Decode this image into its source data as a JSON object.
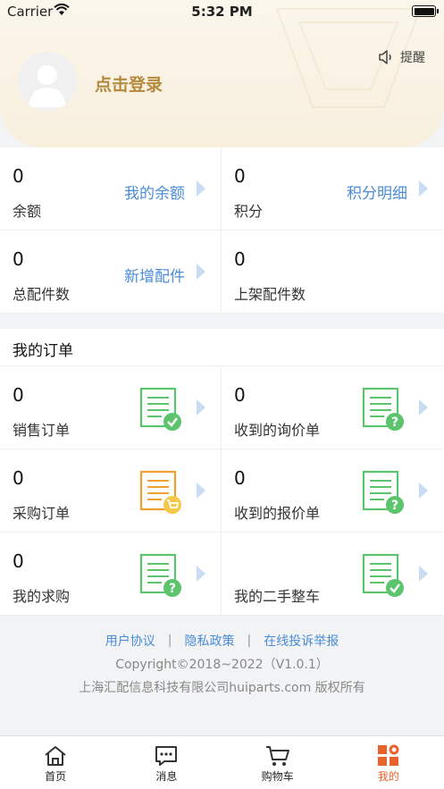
{
  "status_bar": {
    "carrier": "Carrier",
    "time": "5:32 PM"
  },
  "header": {
    "login_text": "点击登录",
    "remind_label": "提醒"
  },
  "account": [
    {
      "value": "0",
      "label": "余额",
      "link": "我的余额"
    },
    {
      "value": "0",
      "label": "积分",
      "link": "积分明细"
    },
    {
      "value": "0",
      "label": "总配件数",
      "link": "新增配件"
    },
    {
      "value": "0",
      "label": "上架配件数",
      "link": ""
    }
  ],
  "orders_title": "我的订单",
  "orders": [
    {
      "value": "0",
      "label": "销售订单",
      "icon": "sales-order-icon",
      "badge": "check"
    },
    {
      "value": "0",
      "label": "收到的询价单",
      "icon": "inquiry-icon",
      "badge": "question"
    },
    {
      "value": "0",
      "label": "采购订单",
      "icon": "purchase-order-icon",
      "badge": "cart"
    },
    {
      "value": "0",
      "label": "收到的报价单",
      "icon": "quotation-icon",
      "badge": "question"
    },
    {
      "value": "0",
      "label": "我的求购",
      "icon": "wanted-icon",
      "badge": "question"
    },
    {
      "value": "",
      "label": "我的二手整车",
      "icon": "used-car-icon",
      "badge": "check"
    }
  ],
  "footer": {
    "user_agreement": "用户协议",
    "privacy_policy": "隐私政策",
    "complaint": "在线投诉举报",
    "separator": "|",
    "copyright": "Copyright©2018~2022（V1.0.1）",
    "company": "上海汇配信息科技有限公司huiparts.com 版权所有"
  },
  "tabs": [
    {
      "label": "首页",
      "icon": "home-icon"
    },
    {
      "label": "消息",
      "icon": "message-icon"
    },
    {
      "label": "购物车",
      "icon": "cart-icon"
    },
    {
      "label": "我的",
      "icon": "mine-icon",
      "active": true
    }
  ],
  "colors": {
    "accent": "#e8622a",
    "link": "#4a8cd6",
    "gold": "#b48a3c",
    "green": "#5cc46d",
    "orange": "#f0a030"
  }
}
